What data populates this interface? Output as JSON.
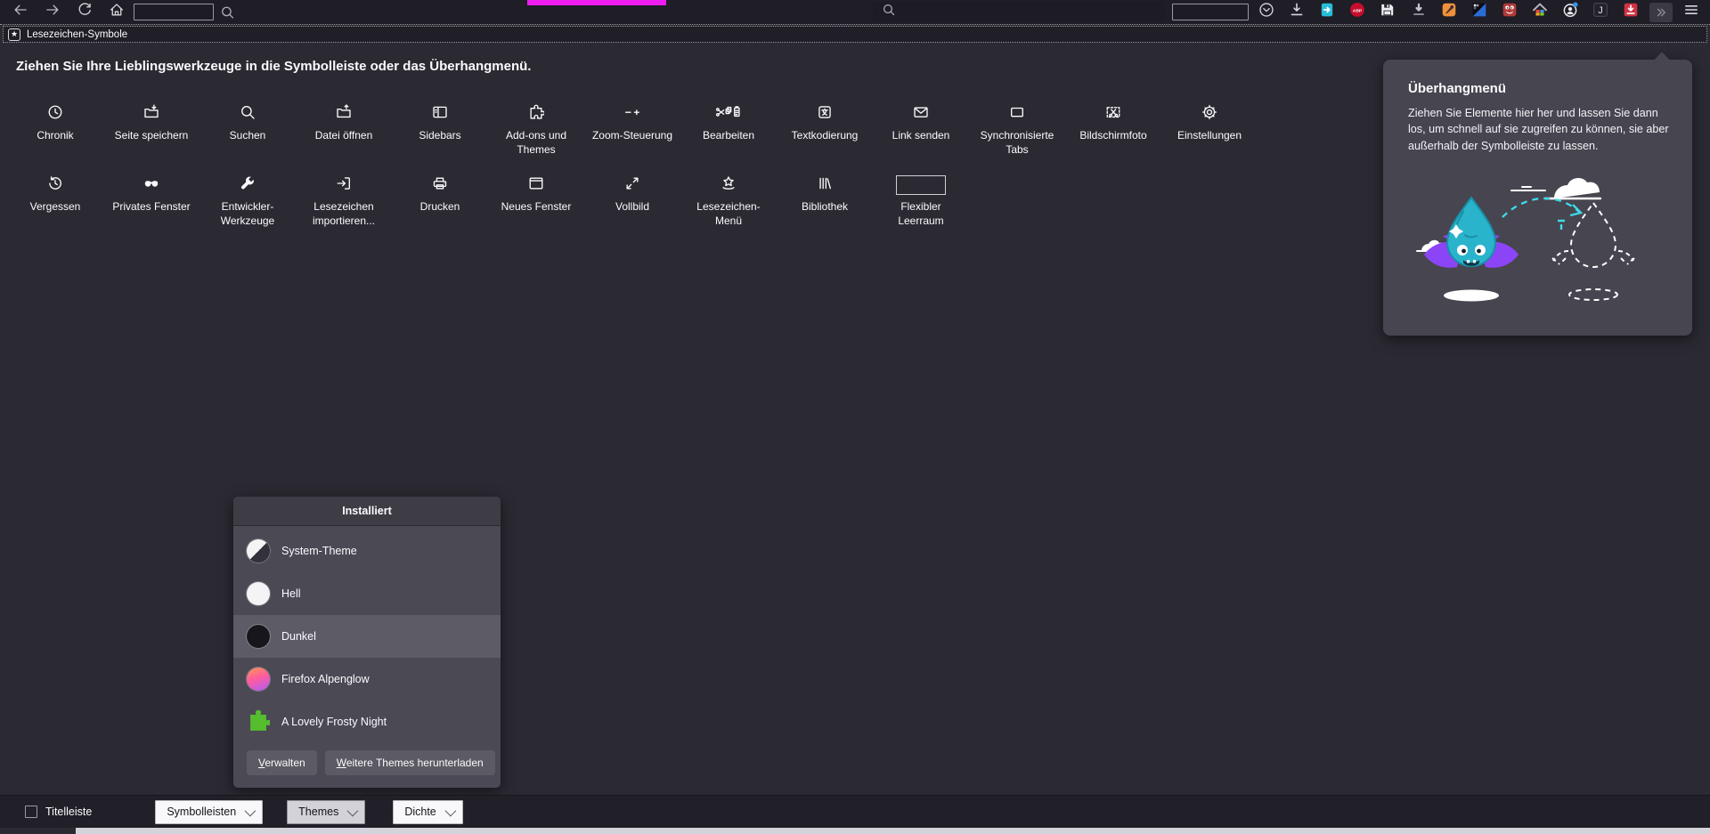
{
  "browser": {
    "nav_icons": [
      "back",
      "forward",
      "reload",
      "home"
    ],
    "tab_indicator_color": "#ef1cef",
    "bookmarks_bar": {
      "label": "Lesezeichen-Symbole",
      "icon": "bookmark-star"
    },
    "right_icons": [
      "pocket",
      "downloads",
      "send-page",
      "adblock-plus",
      "save-disk",
      "download-manager",
      "extension-orange",
      "extension-pixel",
      "extension-smiley",
      "extension-home",
      "account",
      "extension-j",
      "video-download",
      "overflow-chevron",
      "menu"
    ]
  },
  "customize": {
    "instruction": "Ziehen Sie Ihre Lieblingswerkzeuge in die Symbolleiste oder das Überhangmenü.",
    "palette": [
      {
        "icon": "history",
        "label": "Chronik"
      },
      {
        "icon": "save-page",
        "label": "Seite speichern"
      },
      {
        "icon": "search",
        "label": "Suchen"
      },
      {
        "icon": "open-file",
        "label": "Datei öffnen"
      },
      {
        "icon": "sidebars",
        "label": "Sidebars"
      },
      {
        "icon": "addons",
        "label": "Add-ons und Themes"
      },
      {
        "icon": "zoom-controls",
        "label": "Zoom-Steuerung"
      },
      {
        "icon": "edit",
        "label": "Bearbeiten"
      },
      {
        "icon": "text-encoding",
        "label": "Textkodierung"
      },
      {
        "icon": "mail",
        "label": "Link senden"
      },
      {
        "icon": "sync-tabs",
        "label": "Synchronisierte Tabs"
      },
      {
        "icon": "screenshot",
        "label": "Bildschirmfoto"
      },
      {
        "icon": "settings",
        "label": "Einstellungen"
      },
      {
        "icon": "forget",
        "label": "Vergessen"
      },
      {
        "icon": "private-mask",
        "label": "Privates Fenster"
      },
      {
        "icon": "dev-tools",
        "label": "Entwickler-Werkzeuge"
      },
      {
        "icon": "import-bookmarks",
        "label": "Lesezeichen importieren..."
      },
      {
        "icon": "print",
        "label": "Drucken"
      },
      {
        "icon": "new-window",
        "label": "Neues Fenster"
      },
      {
        "icon": "fullscreen",
        "label": "Vollbild"
      },
      {
        "icon": "bookmarks-menu",
        "label": "Lesezeichen-Menü"
      },
      {
        "icon": "library",
        "label": "Bibliothek"
      },
      {
        "icon": "flexible-space",
        "label": "Flexibler Leerraum"
      }
    ],
    "overflow_panel": {
      "title": "Überhangmenü",
      "description": "Ziehen Sie Elemente hier her und lassen Sie dann los, um schnell auf sie zugreifen zu können, sie aber außerhalb der Symbolleiste zu lassen."
    },
    "theme_panel": {
      "header": "Installiert",
      "themes": [
        {
          "name": "System-Theme",
          "swatch": "half",
          "selected": false
        },
        {
          "name": "Hell",
          "swatch": "light",
          "selected": false
        },
        {
          "name": "Dunkel",
          "swatch": "dark",
          "selected": true
        },
        {
          "name": "Firefox Alpenglow",
          "swatch": "alpenglow",
          "selected": false
        },
        {
          "name": "A Lovely Frosty Night",
          "swatch": "puzzle",
          "selected": false
        }
      ],
      "manage_label": "Verwalten",
      "download_label": "Weitere Themes herunterladen"
    },
    "footer": {
      "titlebar_label": "Titelleiste",
      "titlebar_checked": false,
      "dropdowns": [
        {
          "label": "Symbolleisten",
          "active": false
        },
        {
          "label": "Themes",
          "active": true
        },
        {
          "label": "Dichte",
          "active": false
        }
      ]
    }
  }
}
